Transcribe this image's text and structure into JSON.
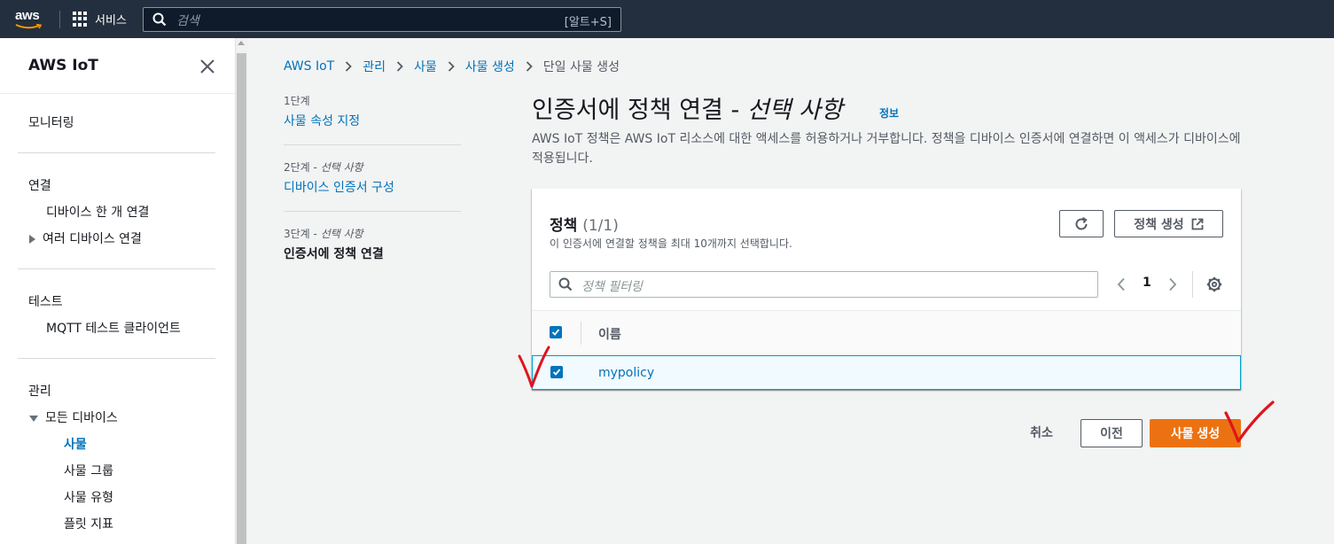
{
  "topnav": {
    "logo": "aws",
    "services_label": "서비스",
    "search_placeholder": "검색",
    "search_shortcut": "[알트+S]"
  },
  "sidebar": {
    "title": "AWS IoT",
    "items": [
      "모니터링",
      "연결",
      "디바이스 한 개 연결",
      "여러 디바이스 연결",
      "테스트",
      "MQTT 테스트 클라이언트",
      "관리",
      "모든 디바이스",
      "사물",
      "사물 그룹",
      "사물 유형",
      "플릿 지표"
    ]
  },
  "breadcrumbs": [
    "AWS IoT",
    "관리",
    "사물",
    "사물 생성",
    "단일 사물 생성"
  ],
  "steps": [
    {
      "label": "1단계",
      "optional": "",
      "title": "사물 속성 지정"
    },
    {
      "label": "2단계 - ",
      "optional": "선택 사항",
      "title": "디바이스 인증서 구성"
    },
    {
      "label": "3단계 - ",
      "optional": "선택 사항",
      "title": "인증서에 정책 연결"
    }
  ],
  "page": {
    "title_main": "인증서에 정책 연결 - ",
    "title_optional": "선택 사항",
    "info": "정보",
    "description": "AWS IoT 정책은 AWS IoT 리소스에 대한 액세스를 허용하거나 거부합니다. 정책을 디바이스 인증서에 연결하면 이 액세스가 디바이스에 적용됩니다."
  },
  "policies": {
    "title": "정책",
    "count": "(1/1)",
    "subtitle": "이 인증서에 연결할 정책을 최대 10개까지 선택합니다.",
    "create_button": "정책 생성",
    "filter_placeholder": "정책 필터링",
    "page_number": "1",
    "column_name": "이름",
    "rows": [
      {
        "name": "mypolicy",
        "selected": true
      }
    ]
  },
  "actions": {
    "cancel": "취소",
    "previous": "이전",
    "submit": "사물 생성"
  },
  "colors": {
    "nav_bg": "#232f3e",
    "link": "#0073bb",
    "primary": "#ec7211",
    "annotation": "#e0141e"
  }
}
